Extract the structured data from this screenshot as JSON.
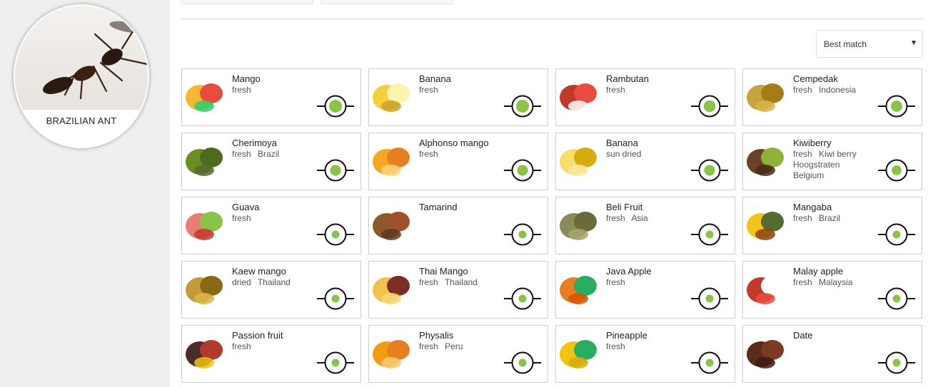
{
  "sidebar": {
    "profile_name": "BRAZILIAN ANT"
  },
  "sort": {
    "selected": "Best match"
  },
  "colors": {
    "accent_green": "#8bc34a",
    "card_border": "#cfcfcf",
    "sidebar_bg": "#efefef"
  },
  "cards": [
    {
      "name": "Mango",
      "tags": [
        "fresh"
      ],
      "match": 1.0
    },
    {
      "name": "Banana",
      "tags": [
        "fresh"
      ],
      "match": 1.0
    },
    {
      "name": "Rambutan",
      "tags": [
        "fresh"
      ],
      "match": 0.9
    },
    {
      "name": "Cempedak",
      "tags": [
        "fresh",
        "Indonesia"
      ],
      "match": 0.85
    },
    {
      "name": "Cherimoya",
      "tags": [
        "fresh",
        "Brazil"
      ],
      "match": 0.8
    },
    {
      "name": "Alphonso mango",
      "tags": [
        "fresh"
      ],
      "match": 0.8
    },
    {
      "name": "Banana",
      "tags": [
        "sun dried"
      ],
      "match": 0.8
    },
    {
      "name": "Kiwiberry",
      "tags": [
        "fresh",
        "Kiwi berry",
        "Hoogstraten",
        "Belgium"
      ],
      "match": 0.7
    },
    {
      "name": "Guava",
      "tags": [
        "fresh"
      ],
      "match": 0.5
    },
    {
      "name": "Tamarind",
      "tags": [],
      "match": 0.5
    },
    {
      "name": "Beli Fruit",
      "tags": [
        "fresh",
        "Asia"
      ],
      "match": 0.5
    },
    {
      "name": "Mangaba",
      "tags": [
        "fresh",
        "Brazil"
      ],
      "match": 0.5
    },
    {
      "name": "Kaew mango",
      "tags": [
        "dried",
        "Thailand"
      ],
      "match": 0.5
    },
    {
      "name": "Thai Mango",
      "tags": [
        "fresh",
        "Thailand"
      ],
      "match": 0.5
    },
    {
      "name": "Java Apple",
      "tags": [
        "fresh"
      ],
      "match": 0.5
    },
    {
      "name": "Malay apple",
      "tags": [
        "fresh",
        "Malaysia"
      ],
      "match": 0.5
    },
    {
      "name": "Passion fruit",
      "tags": [
        "fresh"
      ],
      "match": 0.5
    },
    {
      "name": "Physalis",
      "tags": [
        "fresh",
        "Peru"
      ],
      "match": 0.5
    },
    {
      "name": "Pineapple",
      "tags": [
        "fresh"
      ],
      "match": 0.5
    },
    {
      "name": "Date",
      "tags": [],
      "match": 0.5
    }
  ]
}
